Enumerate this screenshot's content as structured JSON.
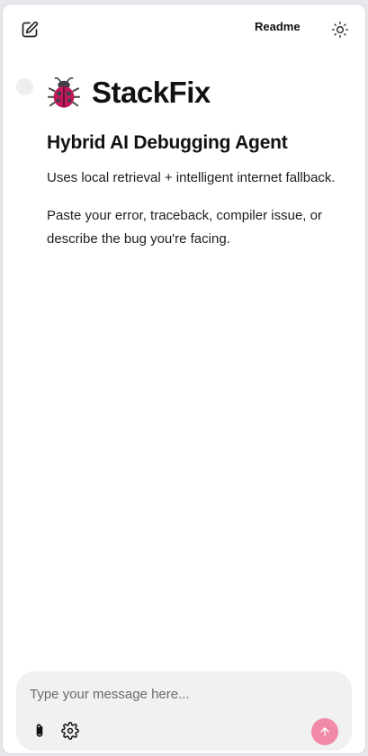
{
  "header": {
    "readme_label": "Readme",
    "new_chat_icon": "edit-icon",
    "theme_icon": "sun-icon"
  },
  "hero": {
    "app_name": "StackFix",
    "logo_icon": "ladybug-icon",
    "heading": "Hybrid AI Debugging Agent",
    "paragraphs": [
      "Uses local retrieval + intelligent internet fallback.",
      "Paste your error, traceback, compiler issue, or describe the bug you're facing."
    ]
  },
  "composer": {
    "placeholder": "Type your message here...",
    "value": "",
    "attach_icon": "paperclip-icon",
    "settings_icon": "gear-icon",
    "send_icon": "arrow-up-icon"
  },
  "colors": {
    "accent": "#f18aa7",
    "composer_bg": "#f1f1f2",
    "text": "#111111"
  }
}
